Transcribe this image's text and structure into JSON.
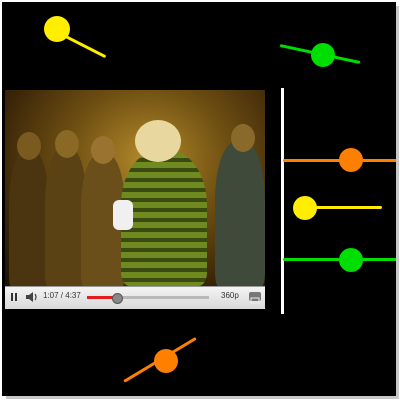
{
  "player": {
    "time_display": "1:07 / 4:37",
    "progress_fraction": 0.243,
    "quality_label": "360p",
    "state": "playing"
  },
  "colors": {
    "background": "#000000",
    "yellow": "#ffee00",
    "orange": "#ff8000",
    "green": "#00dd00",
    "white": "#ffffff",
    "progress": "#e02020"
  },
  "icons": {
    "pause": "pause-icon",
    "volume": "volume-icon",
    "fullscreen": "fullscreen-icon"
  }
}
